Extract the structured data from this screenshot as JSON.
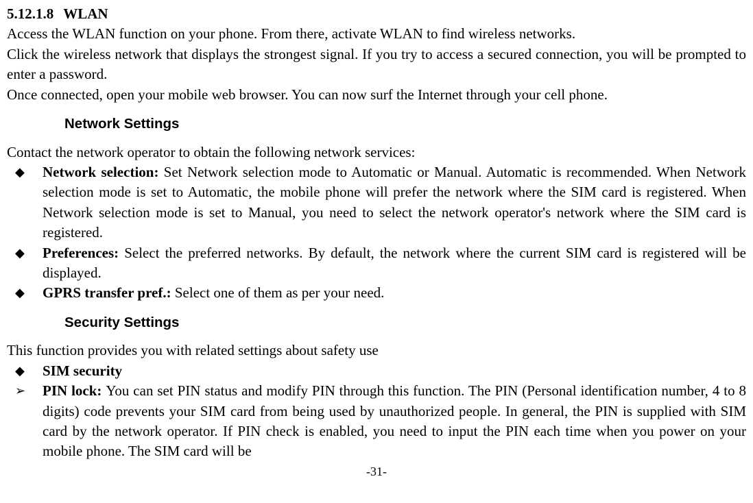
{
  "section": {
    "number": "5.12.1.8",
    "title": "WLAN"
  },
  "wlan": {
    "p1": "Access the WLAN function on your phone. From there, activate WLAN to find wireless networks.",
    "p2": "Click the wireless network that displays the strongest signal. If you try to access a secured connection, you will be prompted to enter a password.",
    "p3": "Once connected, open your mobile web browser. You can now surf the Internet through your cell phone."
  },
  "network": {
    "heading": "Network Settings",
    "intro": "Contact the network operator to obtain the following network services:",
    "items": [
      {
        "label": "Network selection: ",
        "text": "Set Network selection mode to Automatic or Manual. Automatic is recommended. When Network selection mode is set to Automatic, the mobile phone will prefer the network where the SIM card is registered. When Network selection mode is set to Manual, you need to select the network operator's network where the SIM card is registered."
      },
      {
        "label": "Preferences: ",
        "text": "Select the preferred networks. By default, the network where the current SIM card is registered will be displayed."
      },
      {
        "label": "GPRS transfer pref.: ",
        "text": "Select one of them as per your need."
      }
    ]
  },
  "security": {
    "heading": "Security Settings",
    "intro": "This function provides you with related settings about safety use",
    "sim_label": "SIM security",
    "pin": {
      "label": "PIN lock: ",
      "text": "You can set PIN status and modify PIN through this function. The PIN (Personal identification number, 4 to 8 digits) code prevents your SIM card from being used by unauthorized people. In general, the PIN is supplied with SIM card by the network operator. If PIN check is enabled, you need to input the PIN each time when you power on your mobile phone. The SIM card will be"
    }
  },
  "page_num": "-31-"
}
